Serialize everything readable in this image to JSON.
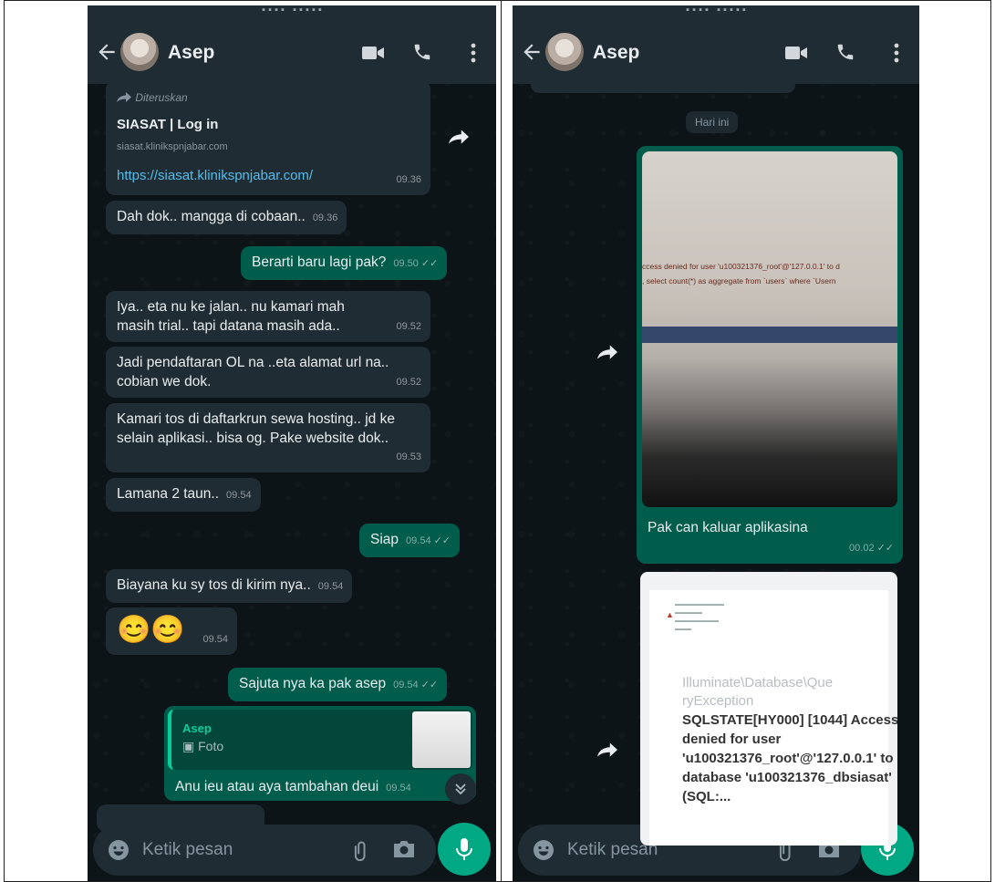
{
  "left": {
    "contact_name": "Asep",
    "messages": {
      "forward_label": "Diteruskan",
      "link_title": "SIASAT | Log in",
      "link_domain": "siasat.klinikspnjabar.com",
      "link_url": "https://siasat.klinikspnjabar.com/",
      "link_time": "09.36",
      "m1": {
        "text": "Dah dok.. mangga di cobaan..",
        "time": "09.36"
      },
      "m2": {
        "text": "Berarti baru lagi pak?",
        "time": "09.50"
      },
      "m3": {
        "text": "Iya.. eta nu ke jalan.. nu kamari mah masih trial.. tapi datana masih ada..",
        "time": "09.52"
      },
      "m4": {
        "text": "Jadi pendaftaran OL na ..eta alamat url na.. cobian we dok.",
        "time": "09.52"
      },
      "m5": {
        "text": "Kamari tos di daftarkrun sewa hosting.. jd ke selain aplikasi.. bisa og. Pake website dok..",
        "time": "09.53"
      },
      "m6": {
        "text": "Lamana 2 taun..",
        "time": "09.54"
      },
      "m7": {
        "text": "Siap",
        "time": "09.54"
      },
      "m8": {
        "text": "Biayana ku sy tos di kirim nya..",
        "time": "09.54"
      },
      "m9": {
        "text": "😊😊",
        "time": "09.54"
      },
      "m10": {
        "text": "Sajuta nya ka pak asep",
        "time": "09.54"
      },
      "reply_name": "Asep",
      "reply_type": "Foto",
      "m11": {
        "text": "Anu ieu atau aya tambahan deui",
        "time": "09.54"
      }
    },
    "composer_placeholder": "Ketik pesan"
  },
  "right": {
    "contact_name": "Asep",
    "date_label": "Hari ini",
    "photo_error_lines": [
      "ccess denied for user 'u100321376_root'@'127.0.0.1' to d",
      ", select count(*) as aggregate from `users` where `Usern"
    ],
    "photo_caption": "Pak can kaluar aplikasina",
    "photo_time": "00.02",
    "doc": {
      "exception_title": "Illuminate\\Database\\QueryException",
      "sqlstate": "SQLSTATE[HY000] [1044] Access denied for user 'u100321376_root'@'127.0.0.1' to database 'u100321376_dbsiasat' (SQL:..."
    },
    "composer_placeholder": "Ketik pesan"
  },
  "colors": {
    "appbar": "#1f2c34",
    "incoming": "#202c33",
    "outgoing": "#005c4b",
    "accent": "#00a884",
    "link": "#53bdeb"
  },
  "icons": [
    "back-arrow-icon",
    "video-call-icon",
    "phone-icon",
    "more-vert-icon",
    "forward-icon",
    "share-icon",
    "emoji-icon",
    "attach-icon",
    "camera-icon",
    "mic-icon",
    "double-check-icon",
    "scroll-down-icon"
  ]
}
